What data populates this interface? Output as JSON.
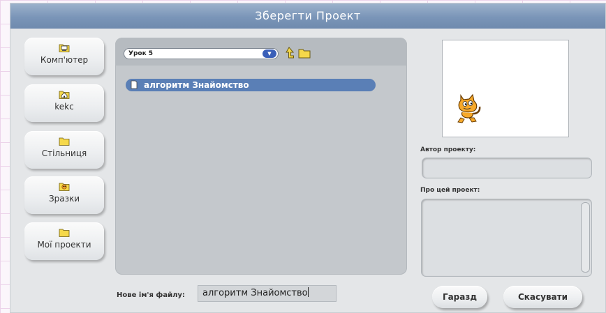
{
  "dialog": {
    "title": "Зберегти Проект"
  },
  "locations": [
    {
      "label": "Комп'ютер",
      "icon": "computer-folder-icon"
    },
    {
      "label": "kekc",
      "icon": "home-folder-icon"
    },
    {
      "label": "Стільниця",
      "icon": "desktop-folder-icon"
    },
    {
      "label": "Зразки",
      "icon": "examples-folder-icon"
    },
    {
      "label": "Мої проекти",
      "icon": "my-projects-folder-icon"
    }
  ],
  "browser": {
    "current_folder": "Урок 5",
    "files": [
      {
        "name": "алгоритм Знайомство",
        "selected": true
      }
    ]
  },
  "project": {
    "author_label": "Автор проекту:",
    "author_value": "",
    "about_label": "Про цей проект:",
    "about_value": ""
  },
  "filename": {
    "label": "Нове ім'я файлу:",
    "value": "алгоритм Знайомство"
  },
  "buttons": {
    "ok": "Гаразд",
    "cancel": "Скасувати"
  },
  "colors": {
    "title_bar": "#7a95b8",
    "selection": "#5a7fb6",
    "dropdown_arrow": "#3a5fb8",
    "folder_icon": "#f5d84a"
  }
}
